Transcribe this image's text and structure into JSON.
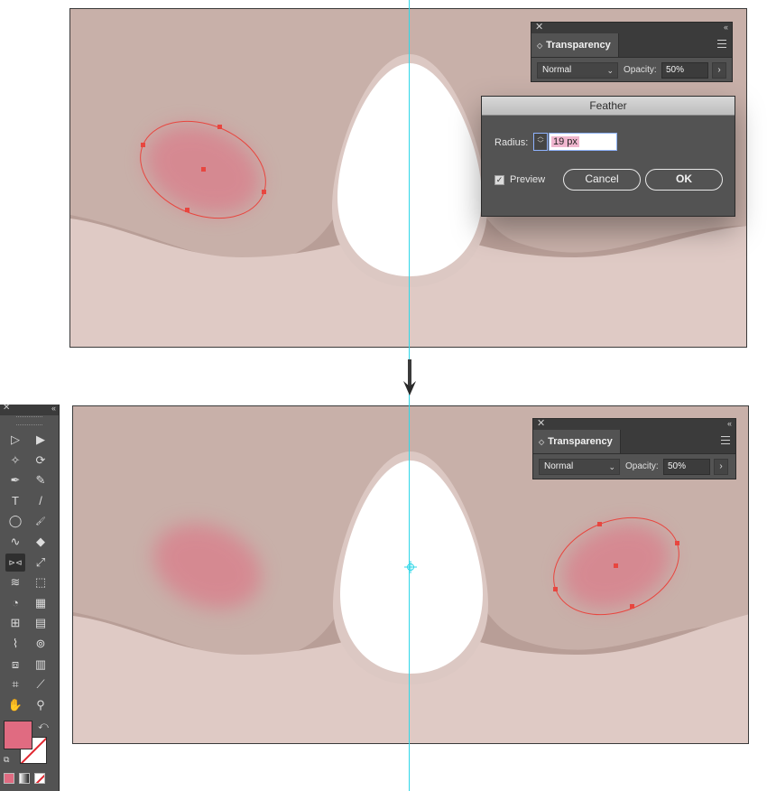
{
  "top_transparency_panel": {
    "close_glyph": "✕",
    "collapse_glyph": "‹‹",
    "tab_label": "Transparency",
    "blend_mode": "Normal",
    "opacity_label": "Opacity:",
    "opacity_value": "50%",
    "more_glyph": "›"
  },
  "bottom_transparency_panel": {
    "close_glyph": "✕",
    "collapse_glyph": "‹‹",
    "tab_label": "Transparency",
    "blend_mode": "Normal",
    "opacity_label": "Opacity:",
    "opacity_value": "50%",
    "more_glyph": "›"
  },
  "feather_dialog": {
    "title": "Feather",
    "radius_label": "Radius:",
    "radius_value": "19 px",
    "preview_label": "Preview",
    "preview_checked": true,
    "cancel_label": "Cancel",
    "ok_label": "OK"
  },
  "tools_panel": {
    "close_glyph": "✕",
    "collapse_glyph": "‹‹",
    "tools": [
      {
        "name": "selection-tool",
        "glyph": "▷"
      },
      {
        "name": "direct-selection-tool",
        "glyph": "▶"
      },
      {
        "name": "magic-wand-tool",
        "glyph": "✧"
      },
      {
        "name": "lasso-tool",
        "glyph": "⟳"
      },
      {
        "name": "pen-tool",
        "glyph": "✒"
      },
      {
        "name": "curvature-tool",
        "glyph": "✎"
      },
      {
        "name": "type-tool",
        "glyph": "T"
      },
      {
        "name": "line-segment-tool",
        "glyph": "/"
      },
      {
        "name": "ellipse-tool",
        "glyph": "◯"
      },
      {
        "name": "paintbrush-tool",
        "glyph": "🖌"
      },
      {
        "name": "shaper-tool",
        "glyph": "∿"
      },
      {
        "name": "eraser-tool",
        "glyph": "◆"
      },
      {
        "name": "reflect-tool",
        "glyph": "⊳⊲"
      },
      {
        "name": "scale-tool",
        "glyph": "⤢"
      },
      {
        "name": "warp-tool",
        "glyph": "≋"
      },
      {
        "name": "free-transform-tool",
        "glyph": "⬚"
      },
      {
        "name": "shape-builder-tool",
        "glyph": "◔"
      },
      {
        "name": "perspective-grid-tool",
        "glyph": "▦"
      },
      {
        "name": "mesh-tool",
        "glyph": "⊞"
      },
      {
        "name": "gradient-tool",
        "glyph": "▤"
      },
      {
        "name": "eyedropper-tool",
        "glyph": "⌇"
      },
      {
        "name": "blend-tool",
        "glyph": "⊚"
      },
      {
        "name": "symbol-sprayer-tool",
        "glyph": "⧈"
      },
      {
        "name": "column-graph-tool",
        "glyph": "▥"
      },
      {
        "name": "artboard-tool",
        "glyph": "⌗"
      },
      {
        "name": "slice-tool",
        "glyph": "⟋"
      },
      {
        "name": "hand-tool",
        "glyph": "✋"
      },
      {
        "name": "zoom-tool",
        "glyph": "⚲"
      }
    ],
    "fill_color": "#e06b81",
    "stroke_color": "#ffffff",
    "swap_glyph": "⤺",
    "default_glyph": "⧉"
  },
  "colors": {
    "background_upper": "#c8b0a9",
    "background_lower": "#dfcac5",
    "blush": "#da7d8a",
    "selection": "#e8463f",
    "guide": "#2fd7e8"
  }
}
